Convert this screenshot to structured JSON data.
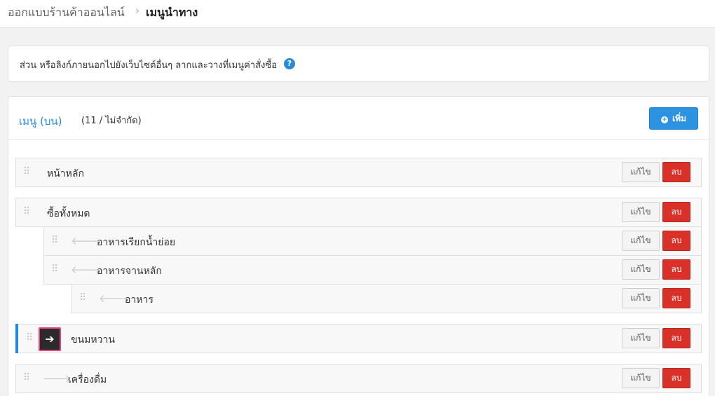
{
  "breadcrumb": {
    "parent": "ออกแบบร้านค้าออนไลน์",
    "separator": "›",
    "current": "เมนูนำทาง"
  },
  "info": {
    "text": "ส่วน หรือลิงก์ภายนอกไปยังเว็บไซต์อื่นๆ ลากและวางที่เมนูค่าสั่งซื้อ",
    "help_icon": "question-circle-icon"
  },
  "menu": {
    "title": "เมนู (บน)",
    "count": "(11 / ไม่จำกัด)",
    "add_label": "เพิ่ม",
    "edit_label": "แก้ไข",
    "delete_label": "ลบ",
    "items": [
      {
        "label": "หน้าหลัก"
      },
      {
        "label": "ซื้อทั้งหมด"
      },
      {
        "label": "อาหารเรียกน้ำย่อย"
      },
      {
        "label": "อาหารจานหลัก"
      },
      {
        "label": "อาหาร"
      },
      {
        "label": "ขนมหวาน"
      },
      {
        "label": "เครื่องดื่ม"
      }
    ]
  },
  "icons": {
    "grip": "drag-handle-icon",
    "indent_left": "arrow-left-icon",
    "indent_right": "arrow-right-icon",
    "add": "plus-circle-icon"
  },
  "colors": {
    "accent": "#2c93e2",
    "danger": "#d93127",
    "highlight_border": "#e8457a"
  }
}
